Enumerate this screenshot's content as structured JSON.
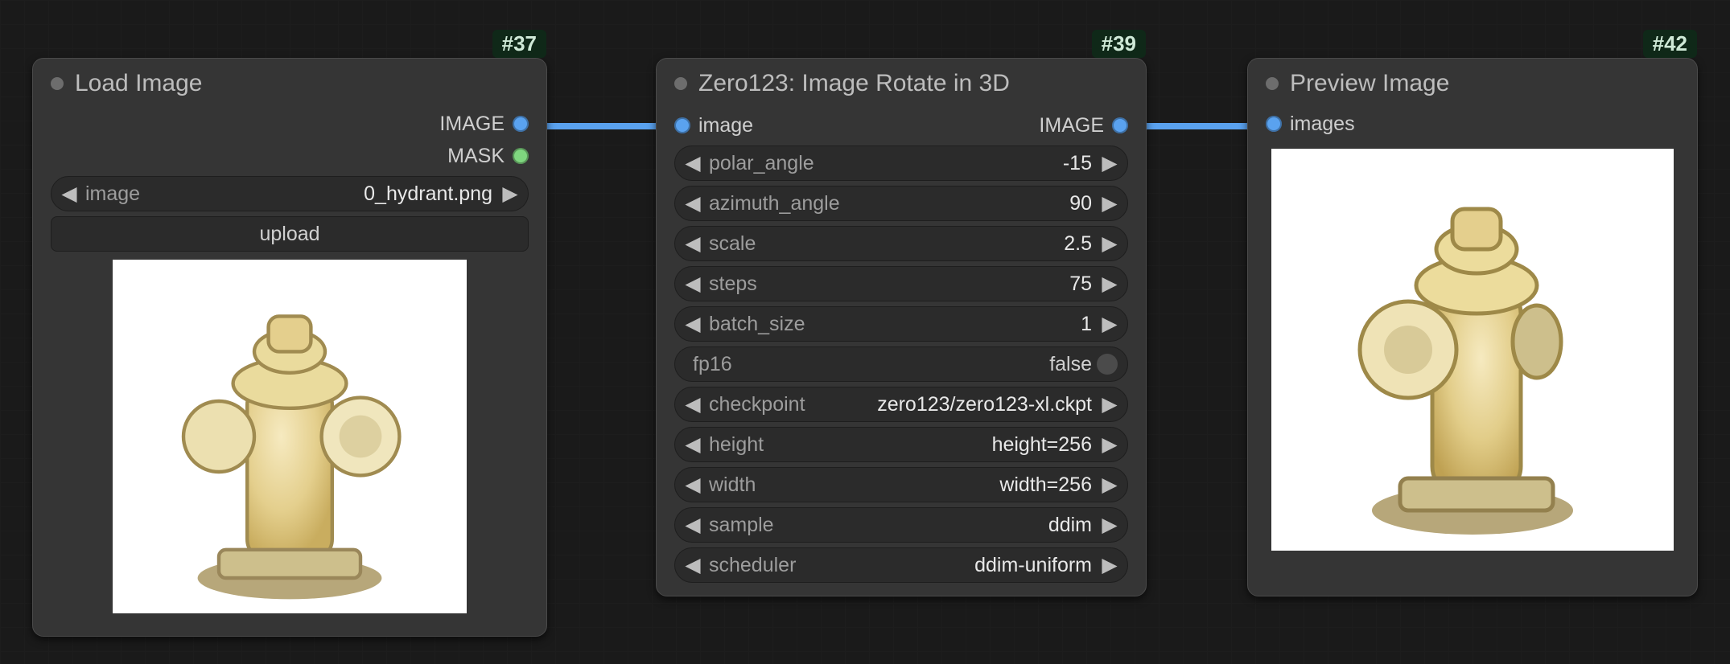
{
  "nodes": {
    "load": {
      "id_badge": "#37",
      "title": "Load Image",
      "outputs": {
        "image": "IMAGE",
        "mask": "MASK"
      },
      "widgets": {
        "file": {
          "label": "image",
          "value": "0_hydrant.png"
        },
        "upload_btn": "upload"
      }
    },
    "zero123": {
      "id_badge": "#39",
      "title": "Zero123: Image Rotate in 3D",
      "inputs": {
        "image": "image"
      },
      "outputs": {
        "image": "IMAGE"
      },
      "widgets": {
        "polar_angle": {
          "label": "polar_angle",
          "value": "-15"
        },
        "azimuth_angle": {
          "label": "azimuth_angle",
          "value": "90"
        },
        "scale": {
          "label": "scale",
          "value": "2.5"
        },
        "steps": {
          "label": "steps",
          "value": "75"
        },
        "batch_size": {
          "label": "batch_size",
          "value": "1"
        },
        "fp16": {
          "label": "fp16",
          "value": "false"
        },
        "checkpoint": {
          "label": "checkpoint",
          "value": "zero123/zero123-xl.ckpt"
        },
        "height": {
          "label": "height",
          "value": "height=256"
        },
        "width": {
          "label": "width",
          "value": "width=256"
        },
        "sample": {
          "label": "sample",
          "value": "ddim"
        },
        "scheduler": {
          "label": "scheduler",
          "value": "ddim-uniform"
        }
      }
    },
    "preview": {
      "id_badge": "#42",
      "title": "Preview Image",
      "inputs": {
        "images": "images"
      }
    }
  },
  "colors": {
    "port_image": "#5aa2ef",
    "port_mask": "#7fd67f",
    "link": "#5aa2ef"
  }
}
